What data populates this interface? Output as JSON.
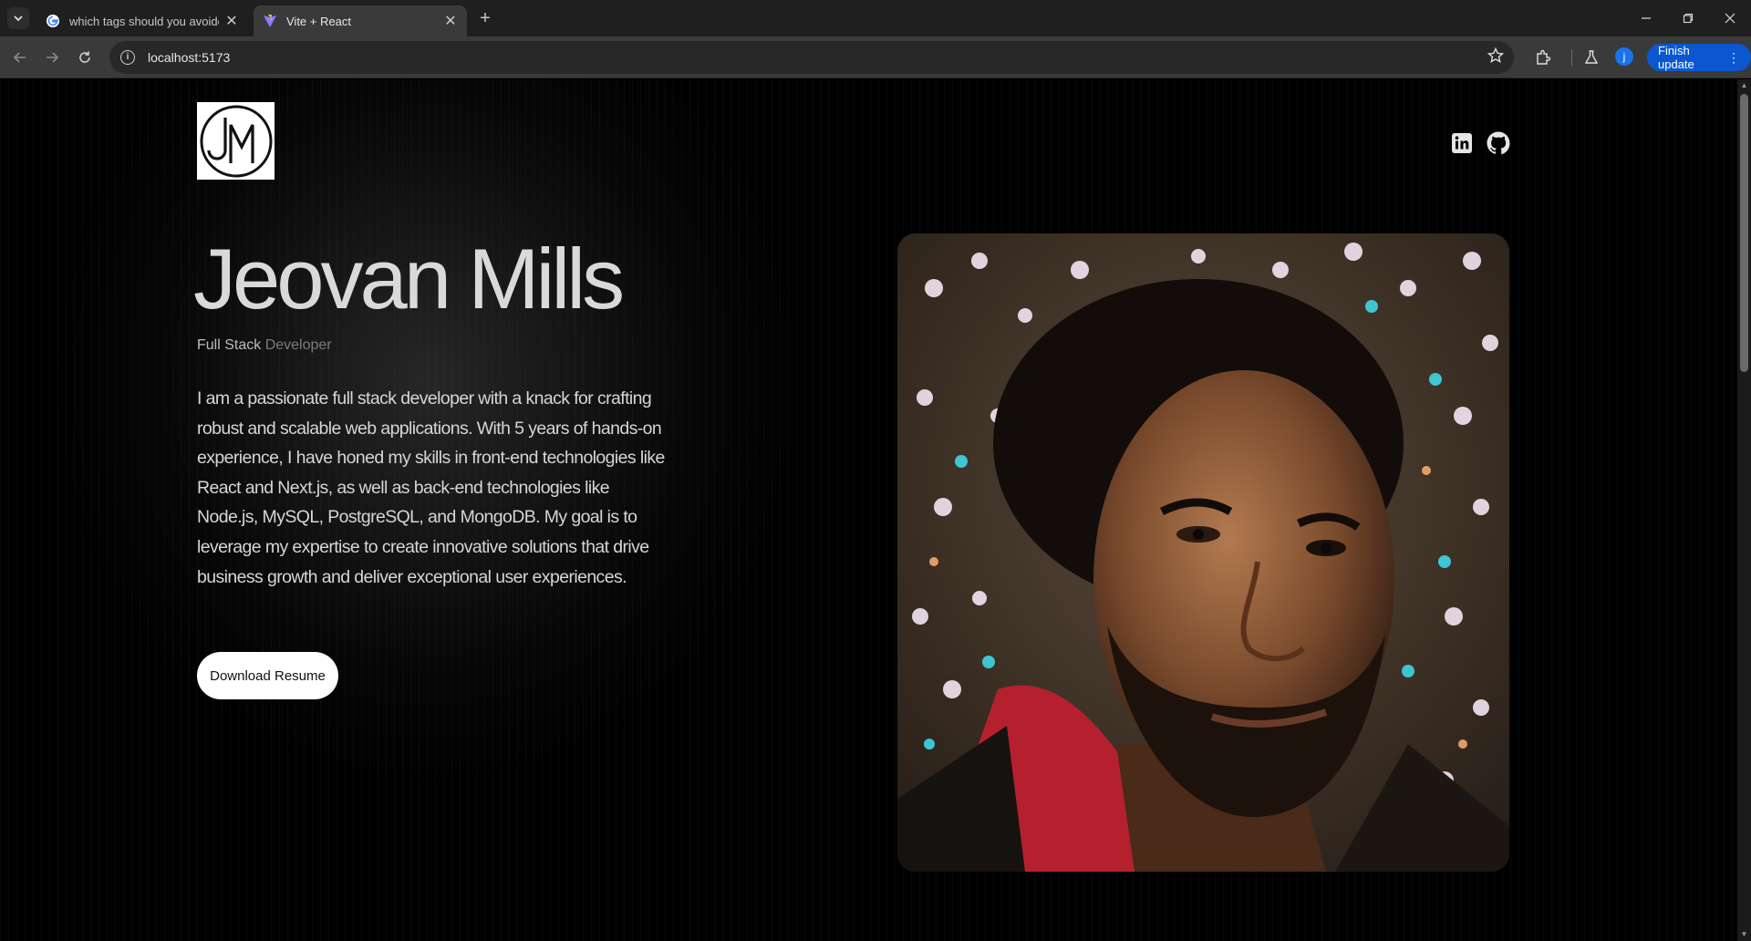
{
  "browser": {
    "tabs": [
      {
        "title": "which tags should you avoide i",
        "active": false
      },
      {
        "title": "Vite + React",
        "active": true
      }
    ],
    "address": "localhost:5173",
    "update_label": "Finish update",
    "profile_initial": "j"
  },
  "page": {
    "logo_text": "JM",
    "name": "Jeovan Mills",
    "role_primary": "Full Stack",
    "role_secondary": "Developer",
    "bio": "I am a passionate full stack developer with a knack for crafting robust and scalable web applications. With 5 years of hands-on experience, I have honed my skills in front-end technologies like React and Next.js, as well as back-end technologies like Node.js, MySQL, PostgreSQL, and MongoDB. My goal is to leverage my expertise to create innovative solutions that drive business growth and deliver exceptional user experiences.",
    "resume_button": "Download Resume",
    "social_icons": [
      "linkedin-icon",
      "github-icon"
    ]
  },
  "colors": {
    "accent_button": "#0b57d0",
    "background": "#000000",
    "name_text": "#d9d9d9"
  }
}
